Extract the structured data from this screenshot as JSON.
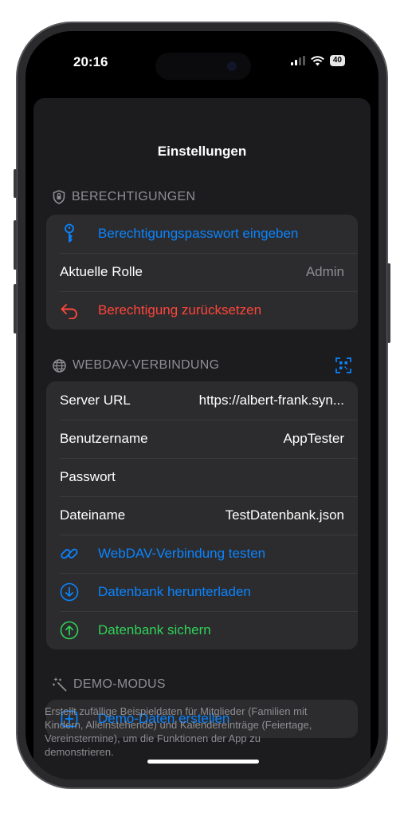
{
  "status": {
    "time": "20:16",
    "battery": "40"
  },
  "title": "Einstellungen",
  "permissions": {
    "header": "BERECHTIGUNGEN",
    "enter_password": "Berechtigungspasswort eingeben",
    "role_label": "Aktuelle Rolle",
    "role_value": "Admin",
    "reset": "Berechtigung zurücksetzen"
  },
  "webdav": {
    "header": "WEBDAV-VERBINDUNG",
    "server_label": "Server URL",
    "server_value": "https://albert-frank.syn...",
    "user_label": "Benutzername",
    "user_value": "AppTester",
    "password_label": "Passwort",
    "filename_label": "Dateiname",
    "filename_value": "TestDatenbank.json",
    "test": "WebDAV-Verbindung testen",
    "download": "Datenbank herunterladen",
    "backup": "Datenbank sichern"
  },
  "demo": {
    "header": "DEMO-MODUS",
    "create": "Demo-Daten erstellen",
    "note": "Erstellt zufällige Beispieldaten für Mitglieder (Familien mit Kindern, Alleinstehende) und Kalendereinträge (Feiertage, Vereinstermine), um die Funktionen der App zu demonstrieren."
  },
  "colors": {
    "accent": "#0a84ff",
    "destructive": "#ff453a",
    "success": "#30d158",
    "background": "#1c1c1e",
    "cell": "#2c2c2e"
  }
}
